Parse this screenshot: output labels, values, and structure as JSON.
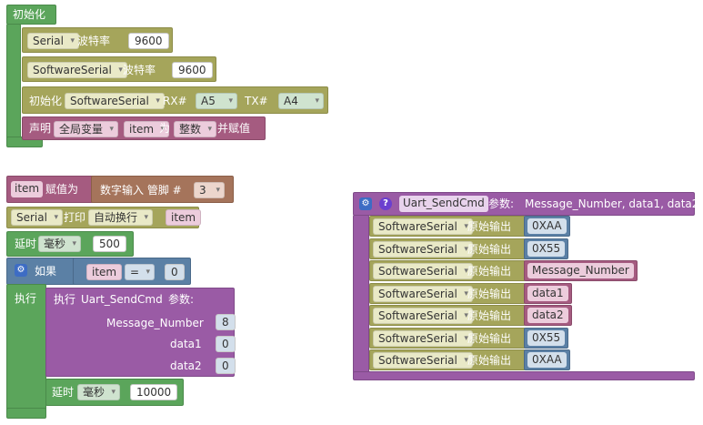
{
  "init": {
    "title": "初始化",
    "serial_dd": "Serial",
    "baud_label": "波特率",
    "serial_baud": "9600",
    "softserial_dd": "SoftwareSerial",
    "softserial_baud_label": "波特率",
    "softserial_baud": "9600",
    "init_label": "初始化",
    "init_dd": "SoftwareSerial",
    "rx_label": "RX#",
    "rx_dd": "A5",
    "tx_label": "TX#",
    "tx_dd": "A4",
    "declare_label": "声明",
    "scope_dd": "全局变量",
    "var_dd": "item",
    "as_label": "为",
    "type_dd": "整数",
    "assign_label": "并赋值"
  },
  "loop": {
    "set_var": "item",
    "set_label": "赋值为",
    "digital_read_label": "数字输入 管脚 #",
    "pin_dd": "3",
    "print_serial_dd": "Serial",
    "print_label": "打印",
    "newline_dd": "自动换行",
    "print_var": "item",
    "delay_label": "延时",
    "delay_unit_dd": "毫秒",
    "delay_value": "500",
    "if_label": "如果",
    "cmp_var": "item",
    "cmp_op": "=",
    "cmp_value": "0",
    "do_label": "执行",
    "call_label": "执行",
    "call_name": "Uart_SendCmd",
    "params_label": "参数:",
    "param1_label": "Message_Number",
    "param1_value": "8",
    "param2_label": "data1",
    "param2_value": "0",
    "param3_label": "data2",
    "param3_value": "0",
    "delay2_label": "延时",
    "delay2_unit_dd": "毫秒",
    "delay2_value": "10000"
  },
  "func": {
    "name": "Uart_SendCmd",
    "params_label": "参数:",
    "params": "Message_Number, data1, data2",
    "raw_label": "原始输出",
    "rows": [
      {
        "serial": "SoftwareSerial",
        "value": "0XAA",
        "kind": "number"
      },
      {
        "serial": "SoftwareSerial",
        "value": "0X55",
        "kind": "number"
      },
      {
        "serial": "SoftwareSerial",
        "value": "Message_Number",
        "kind": "var"
      },
      {
        "serial": "SoftwareSerial",
        "value": "data1",
        "kind": "var"
      },
      {
        "serial": "SoftwareSerial",
        "value": "data2",
        "kind": "var"
      },
      {
        "serial": "SoftwareSerial",
        "value": "0X55",
        "kind": "number"
      },
      {
        "serial": "SoftwareSerial",
        "value": "0XAA",
        "kind": "number"
      }
    ]
  }
}
